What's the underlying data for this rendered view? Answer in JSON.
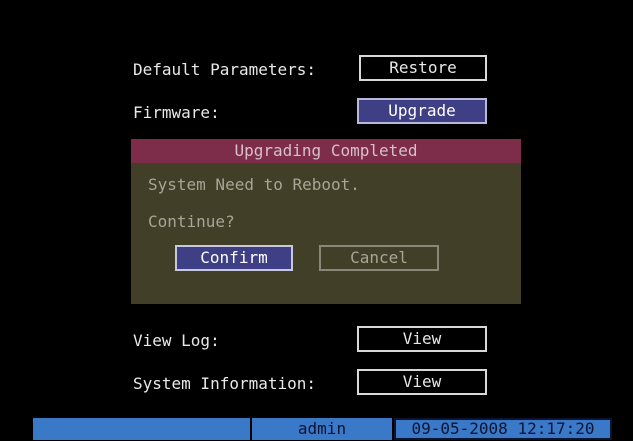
{
  "menu": {
    "default_params": {
      "label": "Default Parameters:",
      "button": "Restore"
    },
    "firmware": {
      "label": "Firmware:",
      "button": "Upgrade"
    },
    "view_log": {
      "label": "View Log:",
      "button": "View"
    },
    "system_info": {
      "label": "System Information:",
      "button": "View"
    }
  },
  "dialog": {
    "title": "Upgrading Completed",
    "message": "System Need to Reboot.",
    "question": "Continue?",
    "confirm": "Confirm",
    "cancel": "Cancel"
  },
  "status_bar": {
    "user": "admin",
    "datetime": "09-05-2008 12:17:20"
  },
  "colors": {
    "focused_button": "#3f3f86",
    "dialog_title": "#7d2d49",
    "dialog_body": "#423f28",
    "status_bar": "#3a78c8"
  }
}
